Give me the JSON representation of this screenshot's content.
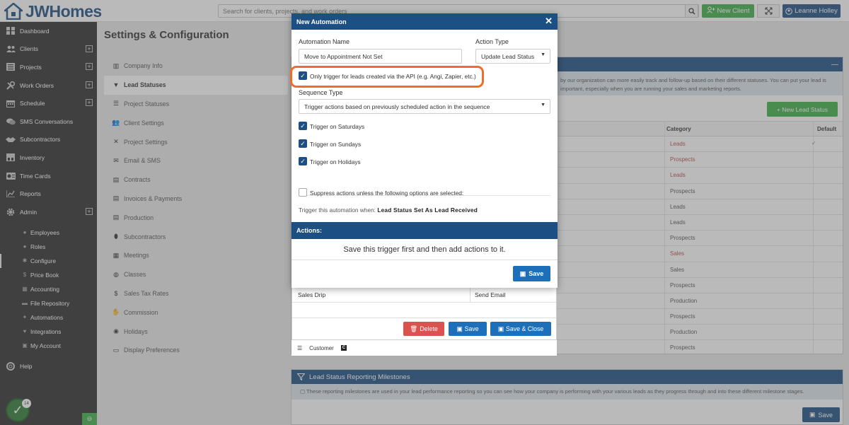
{
  "app": {
    "brand": "JWHomes",
    "search_placeholder": "Search for clients, projects, and work orders",
    "new_client_label": "New Client",
    "user_name": "Leanne Holley"
  },
  "sidebar": {
    "items": [
      {
        "label": "Dashboard",
        "icon": "dashboard-icon",
        "plus": false
      },
      {
        "label": "Clients",
        "icon": "users-icon",
        "plus": true
      },
      {
        "label": "Projects",
        "icon": "projects-icon",
        "plus": true
      },
      {
        "label": "Work Orders",
        "icon": "wrench-icon",
        "plus": true
      },
      {
        "label": "Schedule",
        "icon": "calendar-icon",
        "plus": true
      },
      {
        "label": "SMS Conversations",
        "icon": "chat-icon",
        "plus": false
      },
      {
        "label": "Subcontractors",
        "icon": "handshake-icon",
        "plus": false
      },
      {
        "label": "Inventory",
        "icon": "inventory-icon",
        "plus": false
      },
      {
        "label": "Time Cards",
        "icon": "timecard-icon",
        "plus": false
      },
      {
        "label": "Reports",
        "icon": "reports-icon",
        "plus": false
      },
      {
        "label": "Admin",
        "icon": "gear-icon",
        "plus": true
      }
    ],
    "admin_sub": [
      {
        "label": "Employees",
        "icon": "user-icon"
      },
      {
        "label": "Roles",
        "icon": "user-icon"
      },
      {
        "label": "Configure",
        "icon": "gear-icon"
      },
      {
        "label": "Price Book",
        "icon": "dollar-icon"
      },
      {
        "label": "Accounting",
        "icon": "accounting-icon"
      },
      {
        "label": "File Repository",
        "icon": "folder-icon"
      },
      {
        "label": "Automations",
        "icon": "wand-icon"
      },
      {
        "label": "Integrations",
        "icon": "plug-icon"
      },
      {
        "label": "My Account",
        "icon": "account-icon"
      }
    ],
    "help_label": "Help",
    "fab_badge": "14"
  },
  "settings": {
    "title": "Settings & Configuration",
    "nav": [
      {
        "label": "Company Info",
        "icon": "building-icon"
      },
      {
        "label": "Lead Statuses",
        "icon": "filter-icon"
      },
      {
        "label": "Project Statuses",
        "icon": "list-icon"
      },
      {
        "label": "Client Settings",
        "icon": "users-icon"
      },
      {
        "label": "Project Settings",
        "icon": "wrench-icon"
      },
      {
        "label": "Email & SMS",
        "icon": "envelope-icon"
      },
      {
        "label": "Contracts",
        "icon": "document-icon"
      },
      {
        "label": "Invoices & Payments",
        "icon": "invoice-icon"
      },
      {
        "label": "Production",
        "icon": "clipboard-icon"
      },
      {
        "label": "Subcontractors",
        "icon": "handshake-icon"
      },
      {
        "label": "Meetings",
        "icon": "calendar-icon"
      },
      {
        "label": "Classes",
        "icon": "globe-icon"
      },
      {
        "label": "Sales Tax Rates",
        "icon": "dollar-icon"
      },
      {
        "label": "Commission",
        "icon": "commission-icon"
      },
      {
        "label": "Holidays",
        "icon": "holiday-icon"
      },
      {
        "label": "Display Preferences",
        "icon": "monitor-icon"
      }
    ]
  },
  "lead_status_panel": {
    "info_text": "by our organization can more easily track and follow-up based on their different statuses. You can put your lead is important, especially when you are running your sales and marketing reports.",
    "new_button": "New Lead Status",
    "col_category": "Category",
    "col_default": "Default",
    "rows": [
      {
        "category": "Leads",
        "color": "#b84b4b",
        "default": "✓"
      },
      {
        "category": "Prospects",
        "color": "#b84b4b",
        "default": ""
      },
      {
        "category": "Leads",
        "color": "#b84b4b",
        "default": ""
      },
      {
        "category": "Prospects",
        "color": "#555555",
        "default": ""
      },
      {
        "category": "Leads",
        "color": "#555555",
        "default": ""
      },
      {
        "category": "Leads",
        "color": "#555555",
        "default": ""
      },
      {
        "category": "Prospects",
        "color": "#555555",
        "default": ""
      },
      {
        "category": "Sales",
        "color": "#b84b4b",
        "default": ""
      },
      {
        "category": "Sales",
        "color": "#555555",
        "default": ""
      },
      {
        "category": "Prospects",
        "color": "#555555",
        "default": ""
      },
      {
        "category": "Production",
        "color": "#555555",
        "default": ""
      },
      {
        "category": "Prospects",
        "color": "#555555",
        "default": ""
      },
      {
        "category": "Production",
        "color": "#555555",
        "default": ""
      },
      {
        "category": "Prospects",
        "color": "#555555",
        "default": ""
      }
    ]
  },
  "underlying_form": {
    "row_name": "Sales Drip",
    "row_action": "Send Email",
    "delete_label": "Delete",
    "save_label": "Save",
    "save_close_label": "Save & Close",
    "customer_label": "Customer",
    "customer_badge": "C"
  },
  "milestones": {
    "title": "Lead Status Reporting Milestones",
    "info": "These reporting milestones are used in your lead performance reporting so you can see how your company is performing with your various leads as they progress through and into these different milestone stages.",
    "save_label": "Save"
  },
  "modal": {
    "title": "New Automation",
    "automation_name_label": "Automation Name",
    "automation_name_value": "Move to Appointment Not Set",
    "action_type_label": "Action Type",
    "action_type_value": "Update Lead Status",
    "api_only_label": "Only trigger for leads created via the API (e.g. Angi, Zapier, etc.)",
    "sequence_type_label": "Sequence Type",
    "sequence_type_value": "Trigger actions based on previously scheduled action in the sequence",
    "trigger_saturdays": "Trigger on Saturdays",
    "trigger_sundays": "Trigger on Sundays",
    "trigger_holidays": "Trigger on Holidays",
    "suppress_label": "Suppress actions unless the following options are selected:",
    "trigger_when_label": "Trigger this automation when:",
    "trigger_when_value": "Lead Status Set As Lead Received",
    "actions_title": "Actions:",
    "actions_message": "Save this trigger first and then add actions to it.",
    "save_label": "Save",
    "highlight_color": "#f06c2a"
  },
  "colors": {
    "brand_blue": "#1c4f84",
    "green": "#3fae49",
    "sidebar_bg": "#2d2d2d",
    "danger": "#d9534f"
  }
}
